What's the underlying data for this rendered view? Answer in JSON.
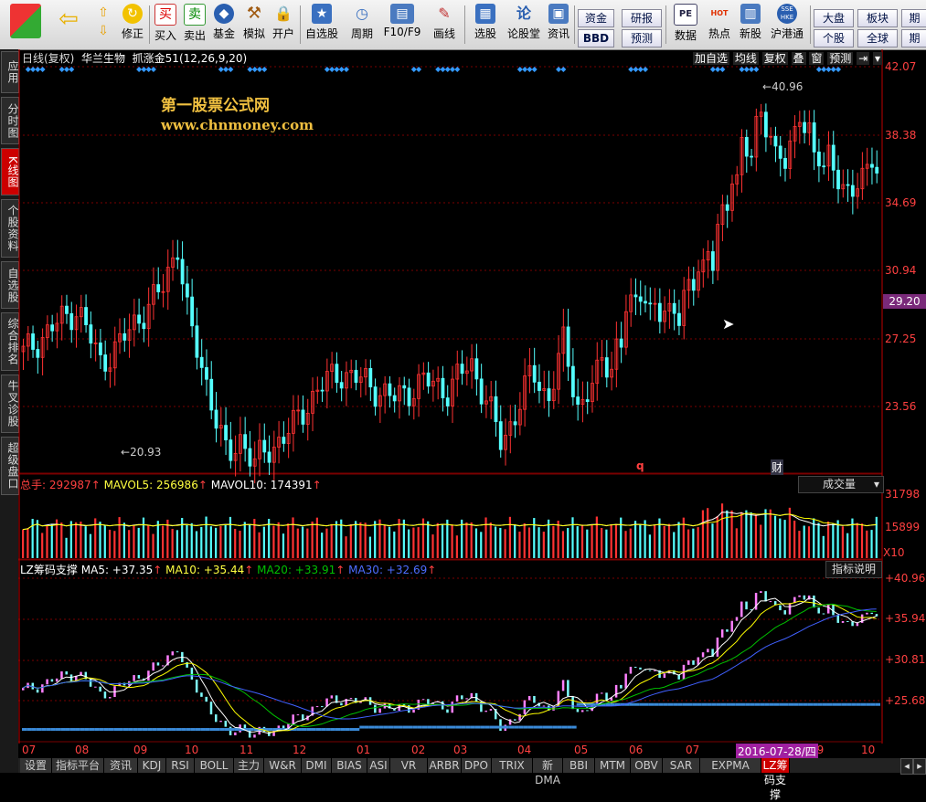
{
  "toolbar": {
    "buttons": [
      {
        "label": "修正",
        "icon": "refresh-icon"
      },
      {
        "label": "买入",
        "icon": "buy-icon"
      },
      {
        "label": "卖出",
        "icon": "sell-icon"
      },
      {
        "label": "基金",
        "icon": "fund-icon"
      },
      {
        "label": "模拟",
        "icon": "hammer-icon"
      },
      {
        "label": "开户",
        "icon": "lock-icon"
      },
      {
        "label": "自选股",
        "icon": "star-icon"
      },
      {
        "label": "周期",
        "icon": "clock-icon"
      },
      {
        "label": "F10/F9",
        "icon": "f10-icon"
      },
      {
        "label": "画线",
        "icon": "pen-icon"
      },
      {
        "label": "选股",
        "icon": "screen-icon"
      },
      {
        "label": "论股堂",
        "icon": "forum-icon"
      },
      {
        "label": "资讯",
        "icon": "news-icon"
      },
      {
        "label": "数据",
        "icon": "pe-icon"
      },
      {
        "label": "热点",
        "icon": "hot-icon"
      },
      {
        "label": "新股",
        "icon": "newstock-icon"
      },
      {
        "label": "沪港通",
        "icon": "hk-icon"
      }
    ],
    "icon_glyphs": {
      "buy": "买",
      "sell": "卖",
      "forum": "论",
      "pe": "PE",
      "hk": "SSE HKE",
      "hot": "HOT"
    },
    "small_buttons": {
      "zijin": "资金",
      "bbd": "BBD",
      "yanbao": "研报",
      "yuce": "预测",
      "dapan": "大盘",
      "bankuai": "板块",
      "qi": "期",
      "gegu": "个股",
      "quanqiu": "全球",
      "qi2": "期"
    }
  },
  "sidebar": [
    "应用",
    "分时图",
    "K线图",
    "个股资料",
    "自选股",
    "综合排名",
    "牛叉诊股",
    "超级盘口"
  ],
  "main": {
    "header": {
      "period": "日线(复权)",
      "stock": "华兰生物",
      "formula": "抓涨金51(12,26,9,20)"
    },
    "right_buttons": [
      "加自选",
      "均线",
      "复权",
      "叠",
      "窗",
      "预测"
    ],
    "watermark": {
      "title": "第一股票公式网",
      "url": "www.chnmoney.com"
    },
    "price_axis": [
      "42.07",
      "38.38",
      "34.69",
      "30.94",
      "27.25",
      "23.56"
    ],
    "current_price": "29.20",
    "high_label": "40.96",
    "low_label": "20.93",
    "markers": {
      "q": "q",
      "cai": "财"
    }
  },
  "volume": {
    "header": {
      "total_label": "总手:",
      "total_value": "292987",
      "ma5_label": "MAVOL5:",
      "ma5_value": "256986",
      "ma10_label": "MAVOL10:",
      "ma10_value": "174391"
    },
    "button": "成交量",
    "axis": [
      "31798",
      "15899"
    ],
    "unit": "X10"
  },
  "indicator": {
    "header": {
      "name": "LZ筹码支撑",
      "ma5": "MA5: +37.35",
      "ma10": "MA10: +35.44",
      "ma20": "MA20: +33.91",
      "ma30": "MA30: +32.69"
    },
    "button": "指标说明",
    "axis": [
      "+40.96",
      "+35.94",
      "+30.81",
      "+25.68"
    ]
  },
  "date_axis": {
    "months": [
      "07",
      "08",
      "09",
      "10",
      "11",
      "12",
      "01",
      "02",
      "03",
      "04",
      "05",
      "06",
      "07",
      "09",
      "10"
    ],
    "highlight": "2016-07-28/四"
  },
  "bottom_tabs": [
    "设置",
    "指标平台",
    "资讯",
    "KDJ",
    "RSI",
    "BOLL",
    "主力",
    "W&R",
    "DMI",
    "BIAS",
    "ASI",
    "VR",
    "ARBR",
    "DPO",
    "TRIX",
    "新DMA",
    "BBI",
    "MTM",
    "OBV",
    "SAR",
    "EXPMA",
    "LZ筹码支撑"
  ],
  "colors": {
    "up": "#ff3232",
    "down": "#54ffff",
    "grid": "#7a0000",
    "axis": "#c00000",
    "ma5": "#ffffff",
    "ma10": "#ffff00",
    "ma20": "#00c000",
    "ma30": "#4060ff",
    "diamond": "#3399ff"
  }
}
